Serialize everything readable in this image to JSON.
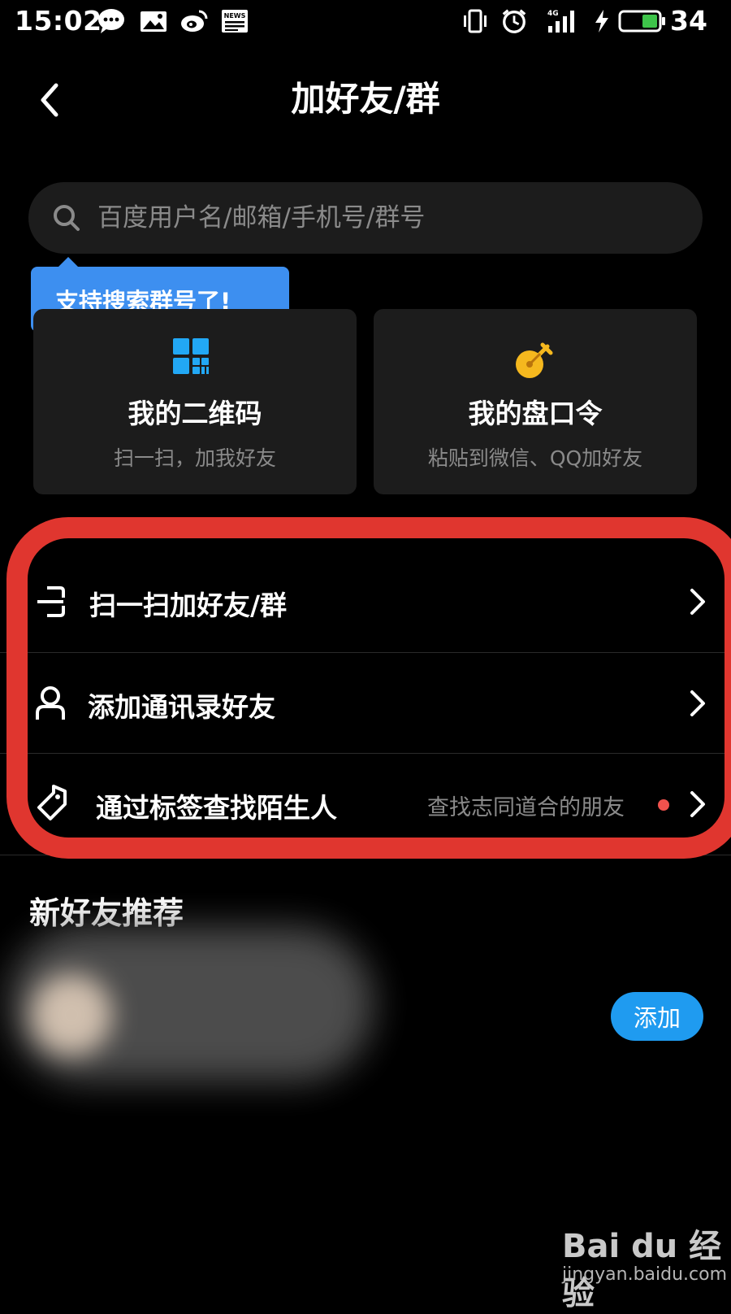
{
  "status_bar": {
    "time": "15:02",
    "signal_label": "4G",
    "battery_level": "34",
    "icons": [
      "message-icon",
      "gallery-icon",
      "weibo-icon",
      "news-icon",
      "vibrate-icon",
      "alarm-icon",
      "signal-icon",
      "charging-icon",
      "battery-icon"
    ]
  },
  "header": {
    "title": "加好友/群",
    "back_icon": "chevron-left-icon"
  },
  "search": {
    "placeholder": "百度用户名/邮箱/手机号/群号",
    "value": ""
  },
  "tooltip": {
    "text": "支持搜索群号了!"
  },
  "cards": [
    {
      "title": "我的二维码",
      "subtitle": "扫一扫，加我好友",
      "icon": "qr-code-icon"
    },
    {
      "title": "我的盘口令",
      "subtitle": "粘贴到微信、QQ加好友",
      "icon": "key-icon"
    }
  ],
  "menu": [
    {
      "label": "扫一扫加好友/群",
      "icon": "scan-icon",
      "hint": ""
    },
    {
      "label": "添加通讯录好友",
      "icon": "contact-icon",
      "hint": ""
    },
    {
      "label": "通过标签查找陌生人",
      "icon": "tag-icon",
      "hint": "查找志同道合的朋友"
    }
  ],
  "recommendations": {
    "title": "新好友推荐",
    "add_label": "添加"
  },
  "watermark": {
    "logo": "Bai du 经验",
    "url": "jingyan.baidu.com"
  },
  "colors": {
    "background": "#000000",
    "card": "#1c1c1c",
    "accent_blue": "#1f9bf0",
    "tooltip_blue": "#3d8ff0",
    "highlight_red": "#e0362f",
    "notification_dot": "#f0524d",
    "key_icon_yellow": "#f5b81e"
  }
}
